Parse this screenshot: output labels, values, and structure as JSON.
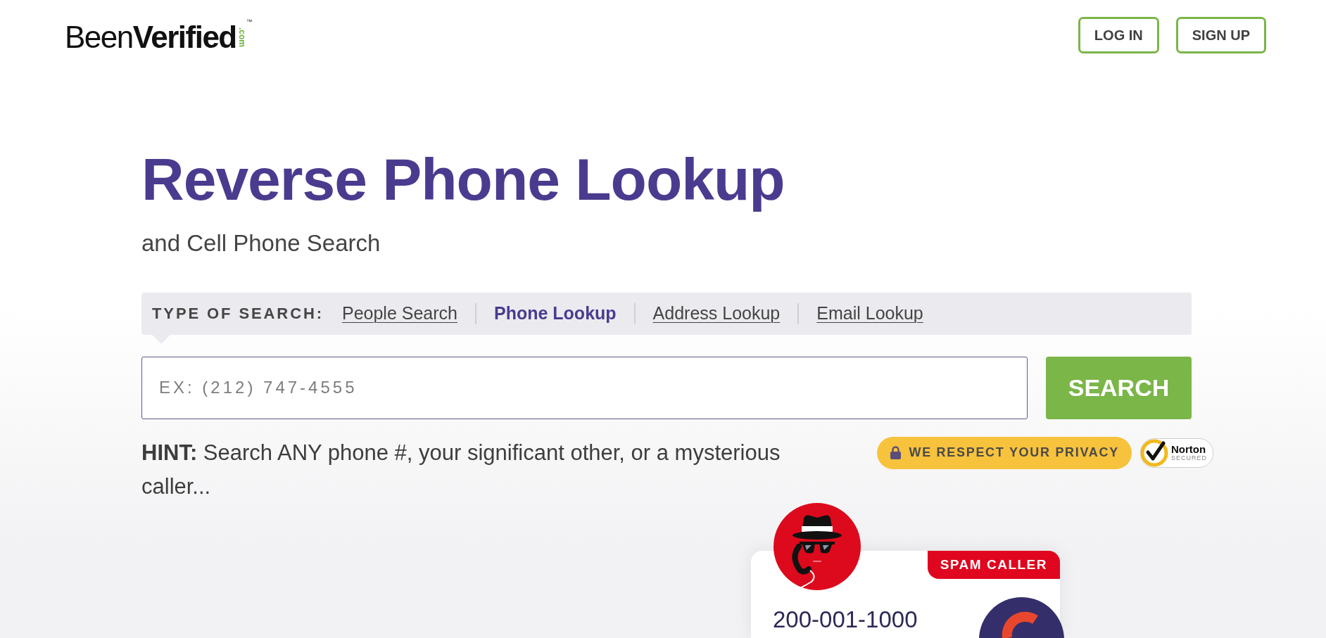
{
  "header": {
    "logo": {
      "wordmark": "Been**Verified**",
      "domain": ".com",
      "trademark": "™"
    },
    "buttons": [
      {
        "label": "LOG IN"
      },
      {
        "label": "SIGN UP"
      }
    ]
  },
  "hero": {
    "title": "Reverse Phone Lookup",
    "subtitle": "and Cell Phone Search"
  },
  "search_type": {
    "label": "TYPE OF SEARCH:",
    "options": [
      {
        "label": "People Search",
        "selected": false
      },
      {
        "label": "Phone Lookup",
        "selected": true
      },
      {
        "label": "Address Lookup",
        "selected": false
      },
      {
        "label": "Email Lookup",
        "selected": false
      }
    ]
  },
  "search": {
    "placeholder": "EX: (212) 747-4555",
    "button": "SEARCH"
  },
  "hint": "**HINT:** Search ANY phone #, your significant other, or a mysterious caller...",
  "privacy_badge": "WE RESPECT YOUR PRIVACY",
  "norton": {
    "name": "Norton",
    "status": "SECURED"
  },
  "caller_card": {
    "tag": "SPAM CALLER",
    "number": "200-001-1000"
  }
}
